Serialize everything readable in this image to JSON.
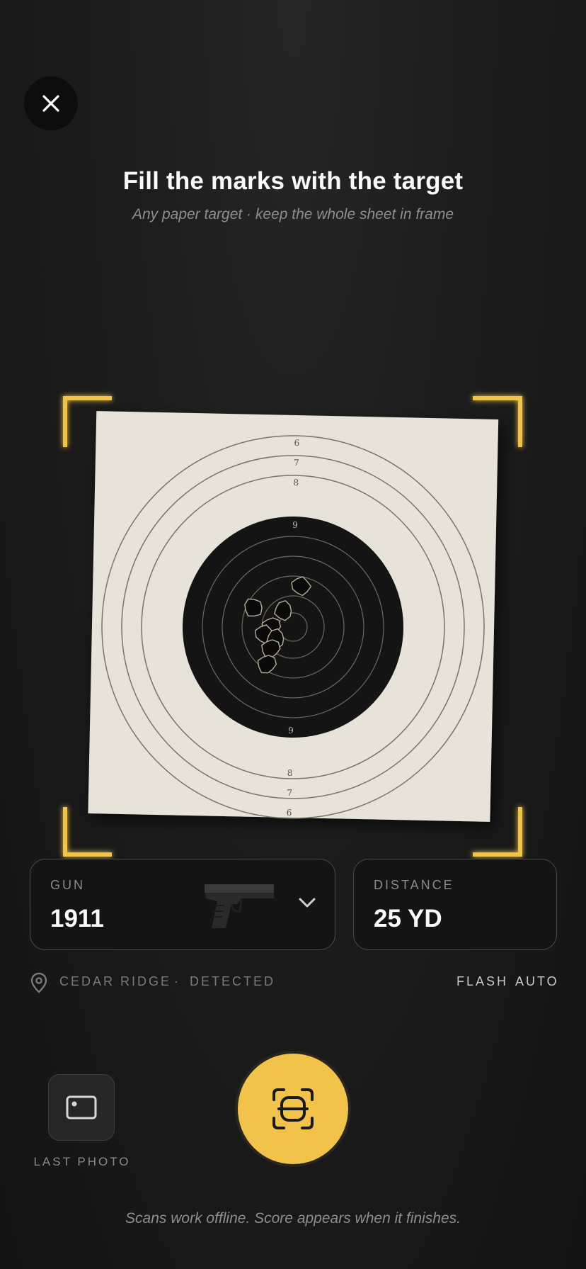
{
  "header": {
    "close_icon": "close-icon",
    "title": "Fill the marks with the target",
    "subtitle": "Any paper target · keep the whole sheet in frame"
  },
  "target": {
    "ring_labels_top": [
      "6",
      "7",
      "8",
      "9"
    ],
    "ring_labels_bottom": [
      "9",
      "8",
      "7",
      "6"
    ],
    "frame_color": "#f2c34a",
    "paper_color": "#e8e3d8",
    "shot_count": 8
  },
  "gun": {
    "label": "GUN",
    "value": "1911",
    "image_icon": "pistol-icon",
    "dropdown_icon": "chevron-down-icon"
  },
  "distance": {
    "label": "DISTANCE",
    "value": "25 YD"
  },
  "meta": {
    "location_icon": "location-pin-icon",
    "location": "CEDAR RIDGE",
    "separator": "·",
    "status": "DETECTED",
    "flash_label": "FLASH",
    "flash_value": "AUTO"
  },
  "controls": {
    "last_photo_label": "LAST PHOTO",
    "last_photo_icon": "photo-icon",
    "shutter_icon": "scan-icon",
    "accent": "#f2c34a"
  },
  "footer": {
    "note": "Scans work offline. Score appears when it finishes."
  }
}
